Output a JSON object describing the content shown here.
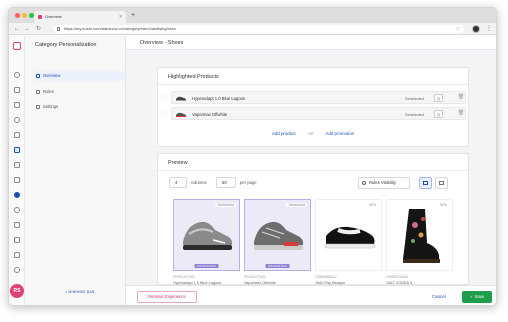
{
  "browser": {
    "tab_title": "Overview",
    "tab_close": "×",
    "new_tab": "+",
    "url": "https://my.nosto.com/admin/xx-xx/category/merchandising/xxxx",
    "nav_back": "←",
    "nav_forward": "→",
    "nav_reload": "↻",
    "menu": "⋮"
  },
  "rail": {
    "avatar_initials": "RS",
    "icons": [
      "logo-icon",
      "speed-icon",
      "thumb-icon",
      "camera-icon",
      "audience-icon",
      "list-icon",
      "category-icon",
      "mail-icon",
      "grid-icon",
      "circle-icon",
      "tag-icon",
      "edit-icon",
      "chart-icon",
      "wrench-icon",
      "settings-icon"
    ]
  },
  "sidebar": {
    "title": "Category Personalization",
    "items": [
      {
        "label": "Overview",
        "active": true,
        "icon": "overview-icon"
      },
      {
        "label": "Rules",
        "active": false,
        "icon": "rules-icon"
      },
      {
        "label": "Settings",
        "active": false,
        "icon": "settings-icon"
      }
    ],
    "minimize": "< MINIMIZE BAR"
  },
  "main": {
    "title": "Overview - Shoes"
  },
  "highlighted": {
    "title": "Highlighted Products",
    "rows": [
      {
        "name": "Hyperadapt 1.0 Blue Lagoon",
        "status": "Scheduled"
      },
      {
        "name": "Vapormax Offwhite",
        "status": "Scheduled"
      }
    ],
    "add_product": "Add product",
    "or": "OR",
    "add_promotion": "Add promotion"
  },
  "preview": {
    "title": "Preview",
    "columns_value": "4",
    "columns_label": "columns",
    "per_page_value": "50",
    "per_page_label": "per page",
    "rules_visibility": "Rules Visibility",
    "products": [
      {
        "badge": "Scheduled",
        "promo": "PROMOTED",
        "id": "PRODUCTNO.",
        "name": "Hyperadapt 1.0 Blue Lagoon",
        "highlight": true
      },
      {
        "badge": "Scheduled",
        "promo": "PROMOTED",
        "id": "PRODUCTNO.",
        "name": "Vapormax Offwhite",
        "highlight": true
      },
      {
        "badge": "92%",
        "promo": "",
        "id": "190654895112",
        "name": "1960 Pay Beaque",
        "highlight": false
      },
      {
        "badge": "92%",
        "promo": "",
        "id": "190655722184",
        "name": "1461 VONDA II",
        "highlight": false
      }
    ]
  },
  "footer": {
    "remove": "Remove Experience",
    "cancel": "Cancel",
    "save": "✓ Save"
  },
  "colors": {
    "accent": "#1f4db8",
    "brand": "#e0407a",
    "save": "#1e9e4a",
    "promoted": "#8d7fd2"
  }
}
